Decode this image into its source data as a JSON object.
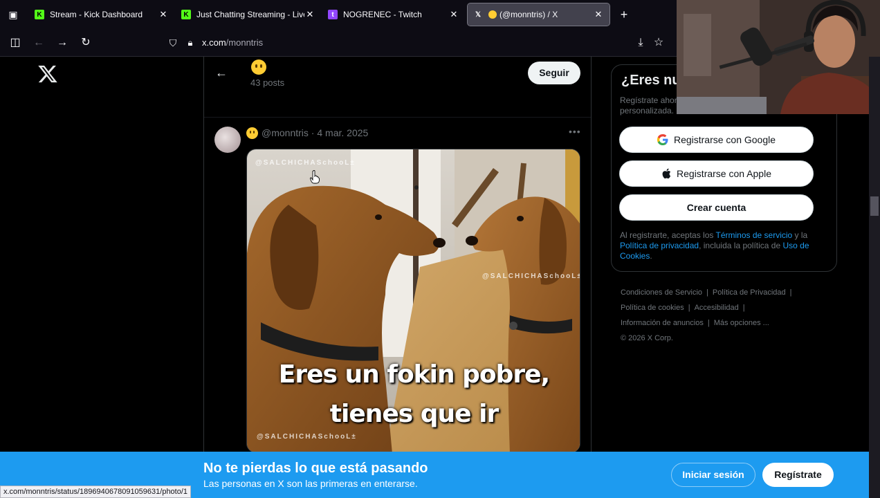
{
  "browser": {
    "tabs": [
      {
        "title": "Stream - Kick Dashboard",
        "favicon": "kick-icon",
        "active": false
      },
      {
        "title": "Just Chatting Streaming - Live S",
        "favicon": "kick-icon",
        "active": false
      },
      {
        "title": "NOGRENEC - Twitch",
        "favicon": "twitch-icon",
        "active": false
      },
      {
        "title": "(@monntris) / X",
        "favicon": "x-icon",
        "active": true
      }
    ],
    "url_domain": "x.com",
    "url_path": "/monntris",
    "status_url": "x.com/monntris/status/1896940678091059631/photo/1"
  },
  "profile_header": {
    "post_count": "43 posts",
    "follow_label": "Seguir"
  },
  "post": {
    "handle": "@monntris",
    "date": "4 mar. 2025",
    "meme_line1": "Eres un fokin pobre,",
    "meme_line2": "tienes que ir",
    "watermark": "@SALCHICHASchooL±"
  },
  "signup_card": {
    "title": "¿Eres nuevo en X?",
    "subtitle": "Regístrate ahora para obtener tu propia cronología personalizada.",
    "google_label": "Registrarse con Google",
    "apple_label": "Registrarse con Apple",
    "create_label": "Crear cuenta",
    "legal_prefix": "Al registrarte, aceptas los ",
    "terms_link": "Términos de servicio",
    "legal_mid1": " y la ",
    "privacy_link": "Política de privacidad",
    "legal_mid2": ", incluida la política de ",
    "cookies_link": "Uso de Cookies",
    "legal_end": "."
  },
  "footer": {
    "links": [
      "Condiciones de Servicio",
      "Política de Privacidad",
      "Política de cookies",
      "Accesibilidad",
      "Información de anuncios",
      "Más opciones ..."
    ],
    "copyright": "© 2026 X Corp."
  },
  "banner": {
    "title": "No te pierdas lo que está pasando",
    "subtitle": "Las personas en X son las primeras en enterarse.",
    "login_label": "Iniciar sesión",
    "signup_label": "Regístrate"
  },
  "colors": {
    "accent": "#1d9bf0",
    "background": "#000000",
    "kick_green": "#53fc18",
    "twitch_purple": "#9146ff"
  }
}
